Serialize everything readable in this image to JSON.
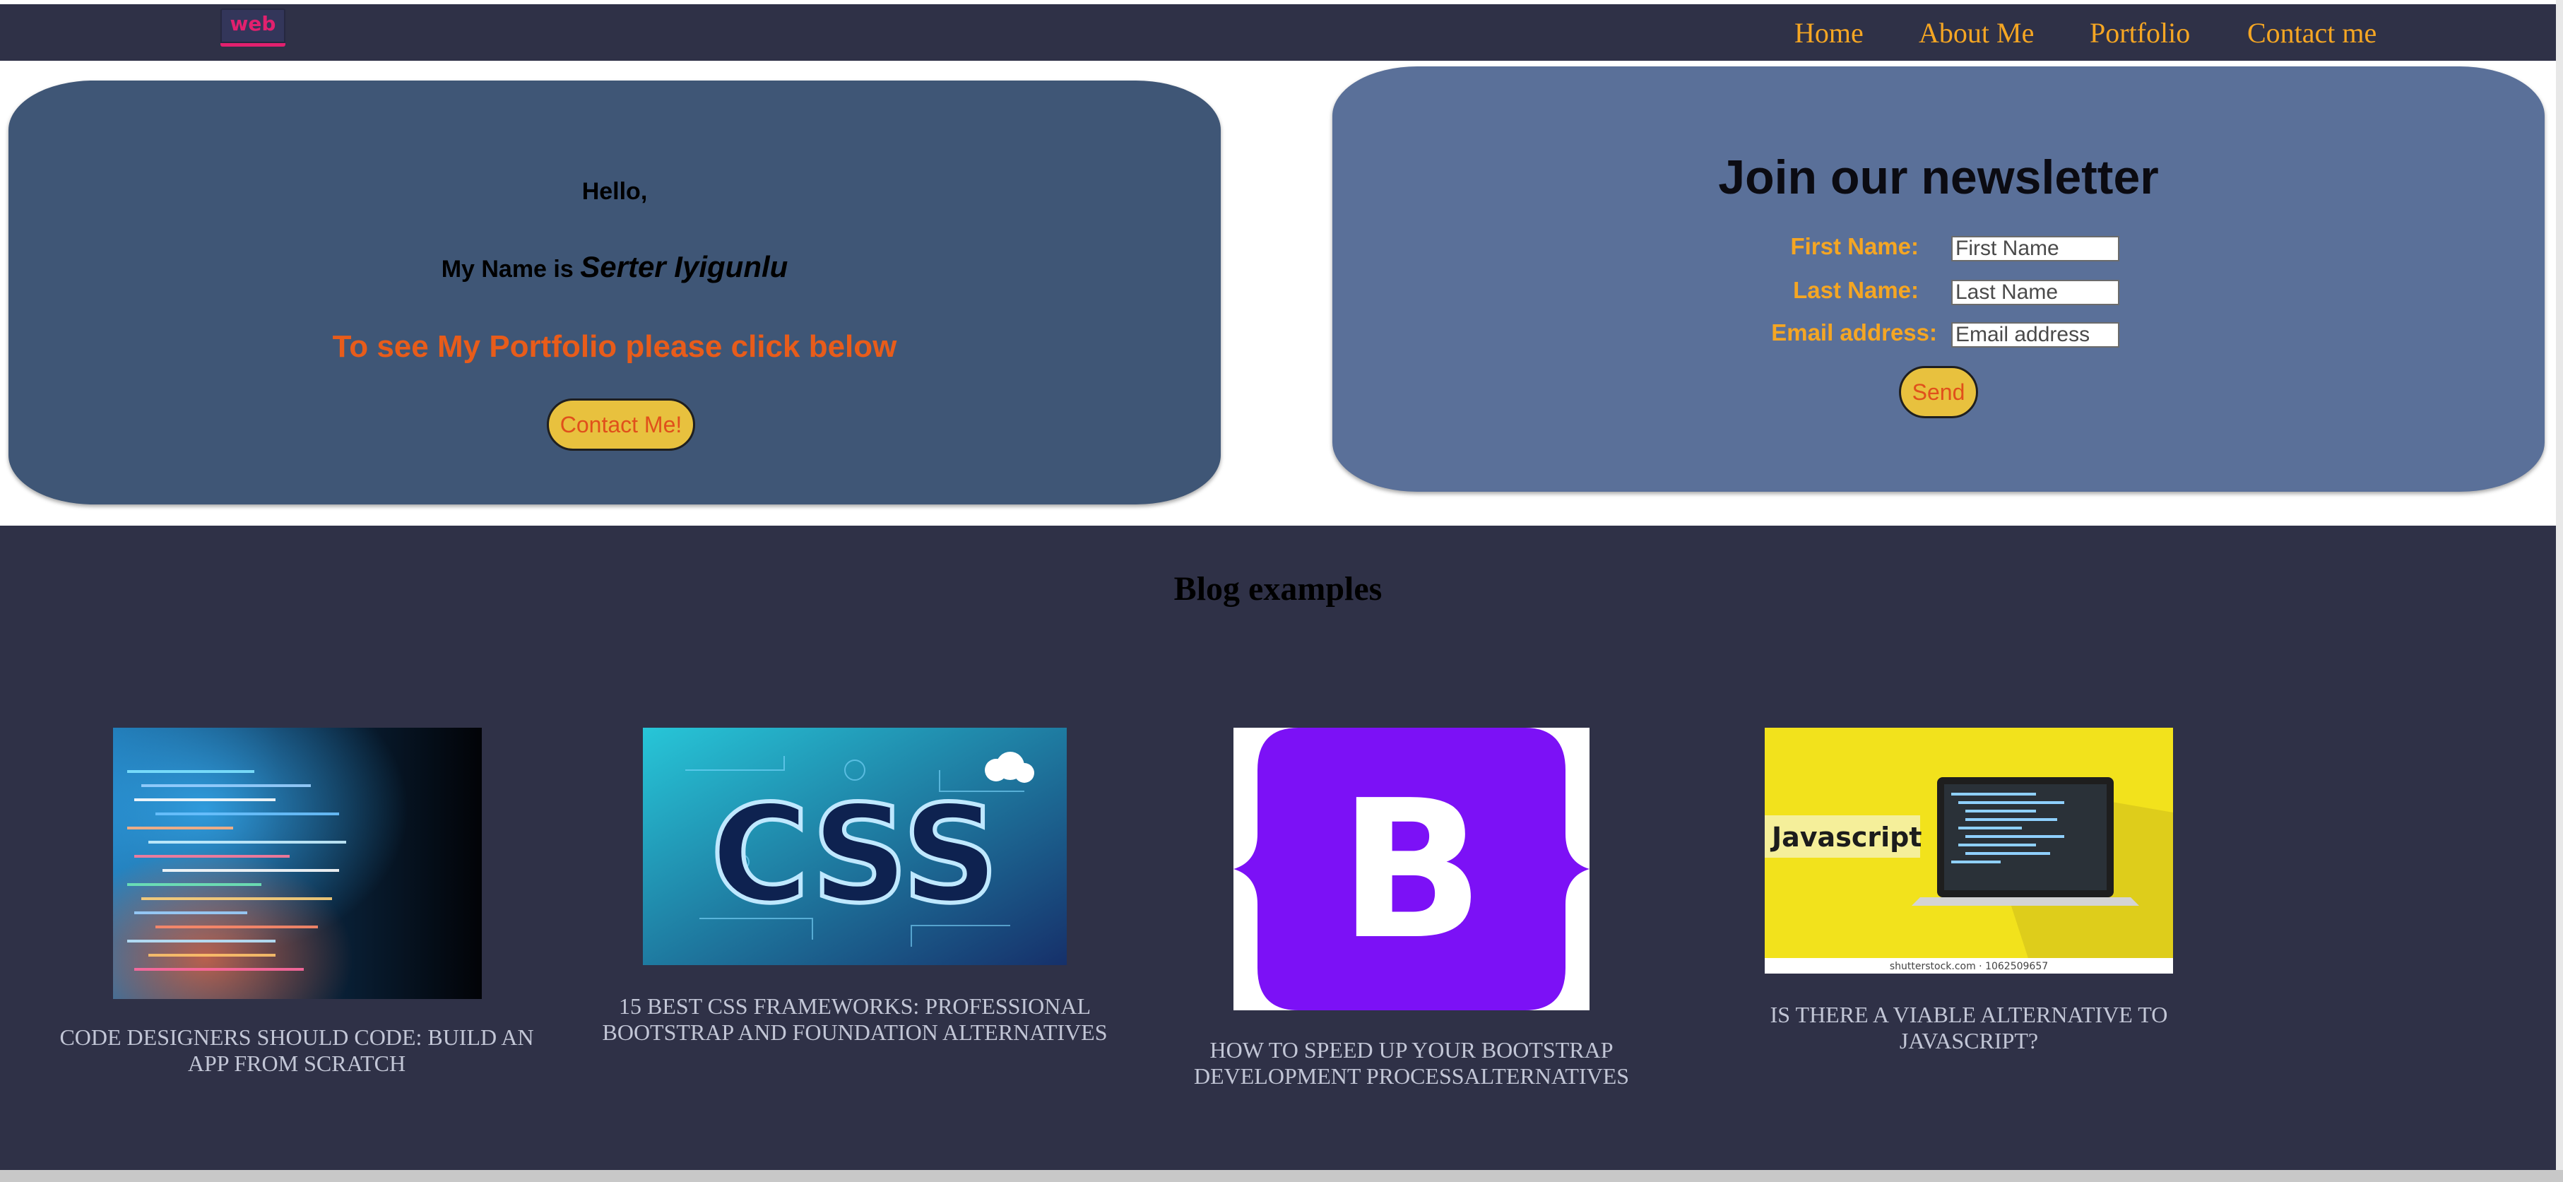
{
  "nav": {
    "logo": "web",
    "items": [
      {
        "label": "Home"
      },
      {
        "label": "About Me"
      },
      {
        "label": "Portfolio"
      },
      {
        "label": "Contact me"
      }
    ]
  },
  "hero": {
    "greeting": "Hello,",
    "name_prefix": "My Name is",
    "name": "Serter Iyigunlu",
    "portfolio_hint": "To see My Portfolio please click below",
    "button_label": "Contact Me!"
  },
  "newsletter": {
    "title": "Join our newsletter",
    "fields": [
      {
        "label": "First Name:",
        "placeholder": "First Name"
      },
      {
        "label": "Last Name:",
        "placeholder": "Last Name"
      },
      {
        "label": "Email address:",
        "placeholder": "Email address"
      }
    ],
    "button_label": "Send"
  },
  "blog": {
    "title": "Blog examples",
    "posts": [
      {
        "title": "Code designers should code: Build an app from scratch",
        "image": "code-screen-image"
      },
      {
        "title": "15 Best CSS Frameworks: Professional Bootstrap and Foundation Alternatives",
        "image": "css-logo-image"
      },
      {
        "title": "How to speed up your Bootstrap development processAlternatives",
        "image": "bootstrap-logo-image",
        "image_text": "B"
      },
      {
        "title": "Is there a viable alternative to JavaScript?",
        "image": "javascript-laptop-image",
        "image_text": "Javascript",
        "image_credit": "shutterstock.com · 1062509657"
      }
    ]
  },
  "colors": {
    "navbar": "#2f3147",
    "nav_link": "#f5a623",
    "hero_card": "#3f5676",
    "newsletter_card": "#5a7099",
    "accent_orange": "#e85c1a",
    "button": "#e8c13e",
    "logo_accent": "#e2206e"
  }
}
